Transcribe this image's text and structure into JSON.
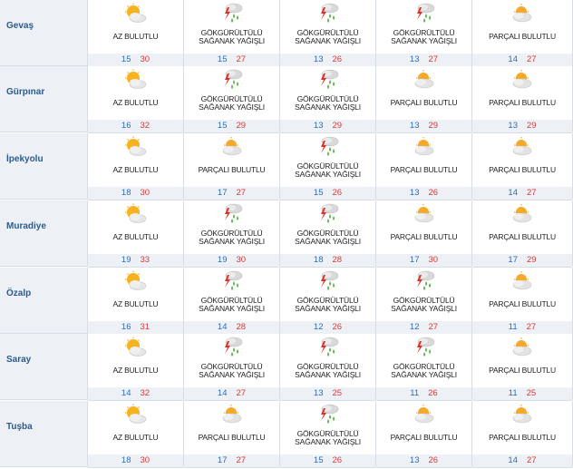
{
  "rows": [
    {
      "city": "Gevaş",
      "days": [
        {
          "cond": "AZ BULUTLU",
          "icon": "sun-cloud-icon",
          "lo": "15",
          "hi": "30"
        },
        {
          "cond": "GÖKGÜRÜLTÜLÜ SAĞANAK YAĞIŞLI",
          "icon": "thunder-rain-icon",
          "lo": "15",
          "hi": "27"
        },
        {
          "cond": "GÖKGÜRÜLTÜLÜ SAĞANAK YAĞIŞLI",
          "icon": "thunder-rain-icon",
          "lo": "13",
          "hi": "26"
        },
        {
          "cond": "GÖKGÜRÜLTÜLÜ SAĞANAK YAĞIŞLI",
          "icon": "thunder-rain-icon",
          "lo": "13",
          "hi": "27"
        },
        {
          "cond": "PARÇALI BULUTLU",
          "icon": "partly-cloudy-icon",
          "lo": "14",
          "hi": "27"
        }
      ]
    },
    {
      "city": "Gürpınar",
      "days": [
        {
          "cond": "AZ BULUTLU",
          "icon": "sun-cloud-icon",
          "lo": "16",
          "hi": "32"
        },
        {
          "cond": "GÖKGÜRÜLTÜLÜ SAĞANAK YAĞIŞLI",
          "icon": "thunder-rain-icon",
          "lo": "15",
          "hi": "29"
        },
        {
          "cond": "GÖKGÜRÜLTÜLÜ SAĞANAK YAĞIŞLI",
          "icon": "thunder-rain-icon",
          "lo": "13",
          "hi": "29"
        },
        {
          "cond": "PARÇALI BULUTLU",
          "icon": "partly-cloudy-icon",
          "lo": "13",
          "hi": "29"
        },
        {
          "cond": "PARÇALI BULUTLU",
          "icon": "partly-cloudy-icon",
          "lo": "13",
          "hi": "29"
        }
      ]
    },
    {
      "city": "İpekyolu",
      "days": [
        {
          "cond": "AZ BULUTLU",
          "icon": "sun-cloud-icon",
          "lo": "18",
          "hi": "30"
        },
        {
          "cond": "PARÇALI BULUTLU",
          "icon": "partly-cloudy-icon",
          "lo": "17",
          "hi": "27"
        },
        {
          "cond": "GÖKGÜRÜLTÜLÜ SAĞANAK YAĞIŞLI",
          "icon": "thunder-rain-icon",
          "lo": "15",
          "hi": "26"
        },
        {
          "cond": "PARÇALI BULUTLU",
          "icon": "partly-cloudy-icon",
          "lo": "13",
          "hi": "26"
        },
        {
          "cond": "PARÇALI BULUTLU",
          "icon": "partly-cloudy-icon",
          "lo": "14",
          "hi": "27"
        }
      ]
    },
    {
      "city": "Muradiye",
      "days": [
        {
          "cond": "AZ BULUTLU",
          "icon": "sun-cloud-icon",
          "lo": "19",
          "hi": "33"
        },
        {
          "cond": "GÖKGÜRÜLTÜLÜ SAĞANAK YAĞIŞLI",
          "icon": "thunder-rain-icon",
          "lo": "19",
          "hi": "30"
        },
        {
          "cond": "GÖKGÜRÜLTÜLÜ SAĞANAK YAĞIŞLI",
          "icon": "thunder-rain-icon",
          "lo": "18",
          "hi": "28"
        },
        {
          "cond": "PARÇALI BULUTLU",
          "icon": "partly-cloudy-icon",
          "lo": "17",
          "hi": "30"
        },
        {
          "cond": "PARÇALI BULUTLU",
          "icon": "partly-cloudy-icon",
          "lo": "17",
          "hi": "29"
        }
      ]
    },
    {
      "city": "Özalp",
      "days": [
        {
          "cond": "AZ BULUTLU",
          "icon": "sun-cloud-icon",
          "lo": "16",
          "hi": "31"
        },
        {
          "cond": "GÖKGÜRÜLTÜLÜ SAĞANAK YAĞIŞLI",
          "icon": "thunder-rain-icon",
          "lo": "14",
          "hi": "28"
        },
        {
          "cond": "GÖKGÜRÜLTÜLÜ SAĞANAK YAĞIŞLI",
          "icon": "thunder-rain-icon",
          "lo": "12",
          "hi": "26"
        },
        {
          "cond": "GÖKGÜRÜLTÜLÜ SAĞANAK YAĞIŞLI",
          "icon": "thunder-rain-icon",
          "lo": "12",
          "hi": "27"
        },
        {
          "cond": "PARÇALI BULUTLU",
          "icon": "partly-cloudy-icon",
          "lo": "11",
          "hi": "27"
        }
      ]
    },
    {
      "city": "Saray",
      "days": [
        {
          "cond": "AZ BULUTLU",
          "icon": "sun-cloud-icon",
          "lo": "14",
          "hi": "32"
        },
        {
          "cond": "GÖKGÜRÜLTÜLÜ SAĞANAK YAĞIŞLI",
          "icon": "thunder-rain-icon",
          "lo": "14",
          "hi": "27"
        },
        {
          "cond": "GÖKGÜRÜLTÜLÜ SAĞANAK YAĞIŞLI",
          "icon": "thunder-rain-icon",
          "lo": "13",
          "hi": "25"
        },
        {
          "cond": "GÖKGÜRÜLTÜLÜ SAĞANAK YAĞIŞLI",
          "icon": "thunder-rain-icon",
          "lo": "11",
          "hi": "26"
        },
        {
          "cond": "PARÇALI BULUTLU",
          "icon": "partly-cloudy-icon",
          "lo": "11",
          "hi": "25"
        }
      ]
    },
    {
      "city": "Tuşba",
      "days": [
        {
          "cond": "AZ BULUTLU",
          "icon": "sun-cloud-icon",
          "lo": "18",
          "hi": "30"
        },
        {
          "cond": "PARÇALI BULUTLU",
          "icon": "partly-cloudy-icon",
          "lo": "17",
          "hi": "27"
        },
        {
          "cond": "GÖKGÜRÜLTÜLÜ SAĞANAK YAĞIŞLI",
          "icon": "thunder-rain-icon",
          "lo": "15",
          "hi": "26"
        },
        {
          "cond": "PARÇALI BULUTLU",
          "icon": "partly-cloudy-icon",
          "lo": "13",
          "hi": "26"
        },
        {
          "cond": "PARÇALI BULUTLU",
          "icon": "partly-cloudy-icon",
          "lo": "14",
          "hi": "27"
        }
      ]
    }
  ],
  "colors": {
    "min_temp": "#2d6db5",
    "max_temp": "#d43b3b",
    "city_text": "#2d5a8c",
    "row_bg": "#edf1f5"
  }
}
